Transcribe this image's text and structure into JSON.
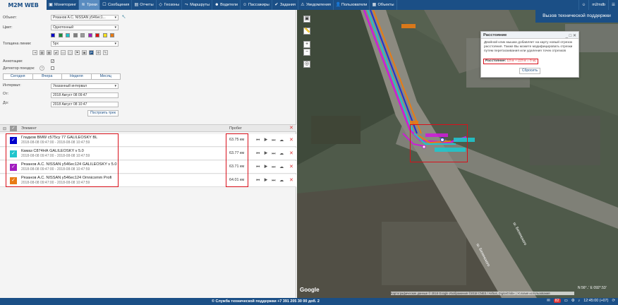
{
  "app": {
    "logo": "M2M WEB",
    "user": "m2mdb",
    "help_button": "Вызов технической поддержки"
  },
  "nav": [
    {
      "label": "Мониторинг",
      "icon": "monitor-icon",
      "active": false
    },
    {
      "label": "Треки",
      "icon": "track-icon",
      "active": true
    },
    {
      "label": "Сообщения",
      "icon": "message-icon",
      "active": false
    },
    {
      "label": "Отчеты",
      "icon": "report-icon",
      "active": false
    },
    {
      "label": "Геозоны",
      "icon": "geofence-icon",
      "active": false
    },
    {
      "label": "Маршруты",
      "icon": "route-icon",
      "active": false
    },
    {
      "label": "Водители",
      "icon": "driver-icon",
      "active": false
    },
    {
      "label": "Пассажиры",
      "icon": "passenger-icon",
      "active": false
    },
    {
      "label": "Задания",
      "icon": "task-icon",
      "active": false
    },
    {
      "label": "Уведомления",
      "icon": "notification-icon",
      "active": false
    },
    {
      "label": "Пользователи",
      "icon": "users-icon",
      "active": false
    },
    {
      "label": "Объекты",
      "icon": "objects-icon",
      "active": false
    }
  ],
  "form": {
    "object_label": "Объект:",
    "object_value": "Рязанов А.С. NISSAN у546ес1...",
    "color_label": "Цвет:",
    "color_value": "Однотонный",
    "palette": [
      "#0000cc",
      "#1d8c3a",
      "#1fc5cc",
      "#7f7f7f",
      "#9b9b9b",
      "#a21ec0",
      "#e11313",
      "#f7e21b",
      "#e87b14"
    ],
    "line_width_label": "Толщина линии:",
    "line_width_value": "5px",
    "annotations_label": "Аннотации:",
    "trip_detector_label": "Детектор поездок:",
    "tabs": [
      "Сегодня",
      "Вчера",
      "Неделя",
      "Месяц"
    ],
    "interval_label": "Интервал:",
    "interval_value": "Указанный интервал",
    "from_label": "От:",
    "from_value": "2018 Август 08 09:47",
    "to_label": "До:",
    "to_value": "2018 Август 08 10:47",
    "build_button": "Построить трек"
  },
  "table": {
    "col_element": "Элемент",
    "col_mileage": "Пробег",
    "rows": [
      {
        "name": "Гладков BMW с575су 77 GALILEOSKY BL",
        "dates": "2018-08-08 09:47:00 - 2018-08-08 10:47:59",
        "km": "63.75 км",
        "color": "#0000cc"
      },
      {
        "name": "Камаз С874НА GALILEOSKY v 5.0",
        "dates": "2018-08-08 09:47:00 - 2018-08-08 10:47:59",
        "km": "63.77 км",
        "color": "#1fc5cc"
      },
      {
        "name": "Рязанов А.С. NISSAN у546ес124 GALILEOSKY v 5.0",
        "dates": "2018-08-08 09:47:00 - 2018-08-08 10:47:59",
        "km": "63.71 км",
        "color": "#a21ec0"
      },
      {
        "name": "Рязанов А.С. NISSAN у546ес124 Omnicomm Profi",
        "dates": "2018-08-08 09:47:00 - 2018-08-08 10:47:59",
        "km": "64.01 км",
        "color": "#e87b14"
      }
    ]
  },
  "popup": {
    "title": "Расстояние",
    "text": "Двойной клик мышки добавляет на карту новый отрезок расстояния. Также Вы можете модифицировать отрезки путем перетаскивания или удаления точек отрезков",
    "dist_label": "Расстояние:",
    "dist_value": "13 м + (13 м = 0 м)",
    "reset": "Сбросить"
  },
  "map": {
    "street1": "ш. Белинского",
    "street2": "ш. Белинского",
    "google": "Google",
    "copyright": "Картографические данные © 2018 Google Изображения ©2018 CNES / Airbus, DigitalGlobe | Условия использования",
    "coords": "N 56°..' E 092°.53'"
  },
  "bottom": {
    "support": "© Служба технической поддержки +7 391 205 30 00 доб. 2",
    "badge": "82",
    "time": "12:45:00 (+07)"
  }
}
